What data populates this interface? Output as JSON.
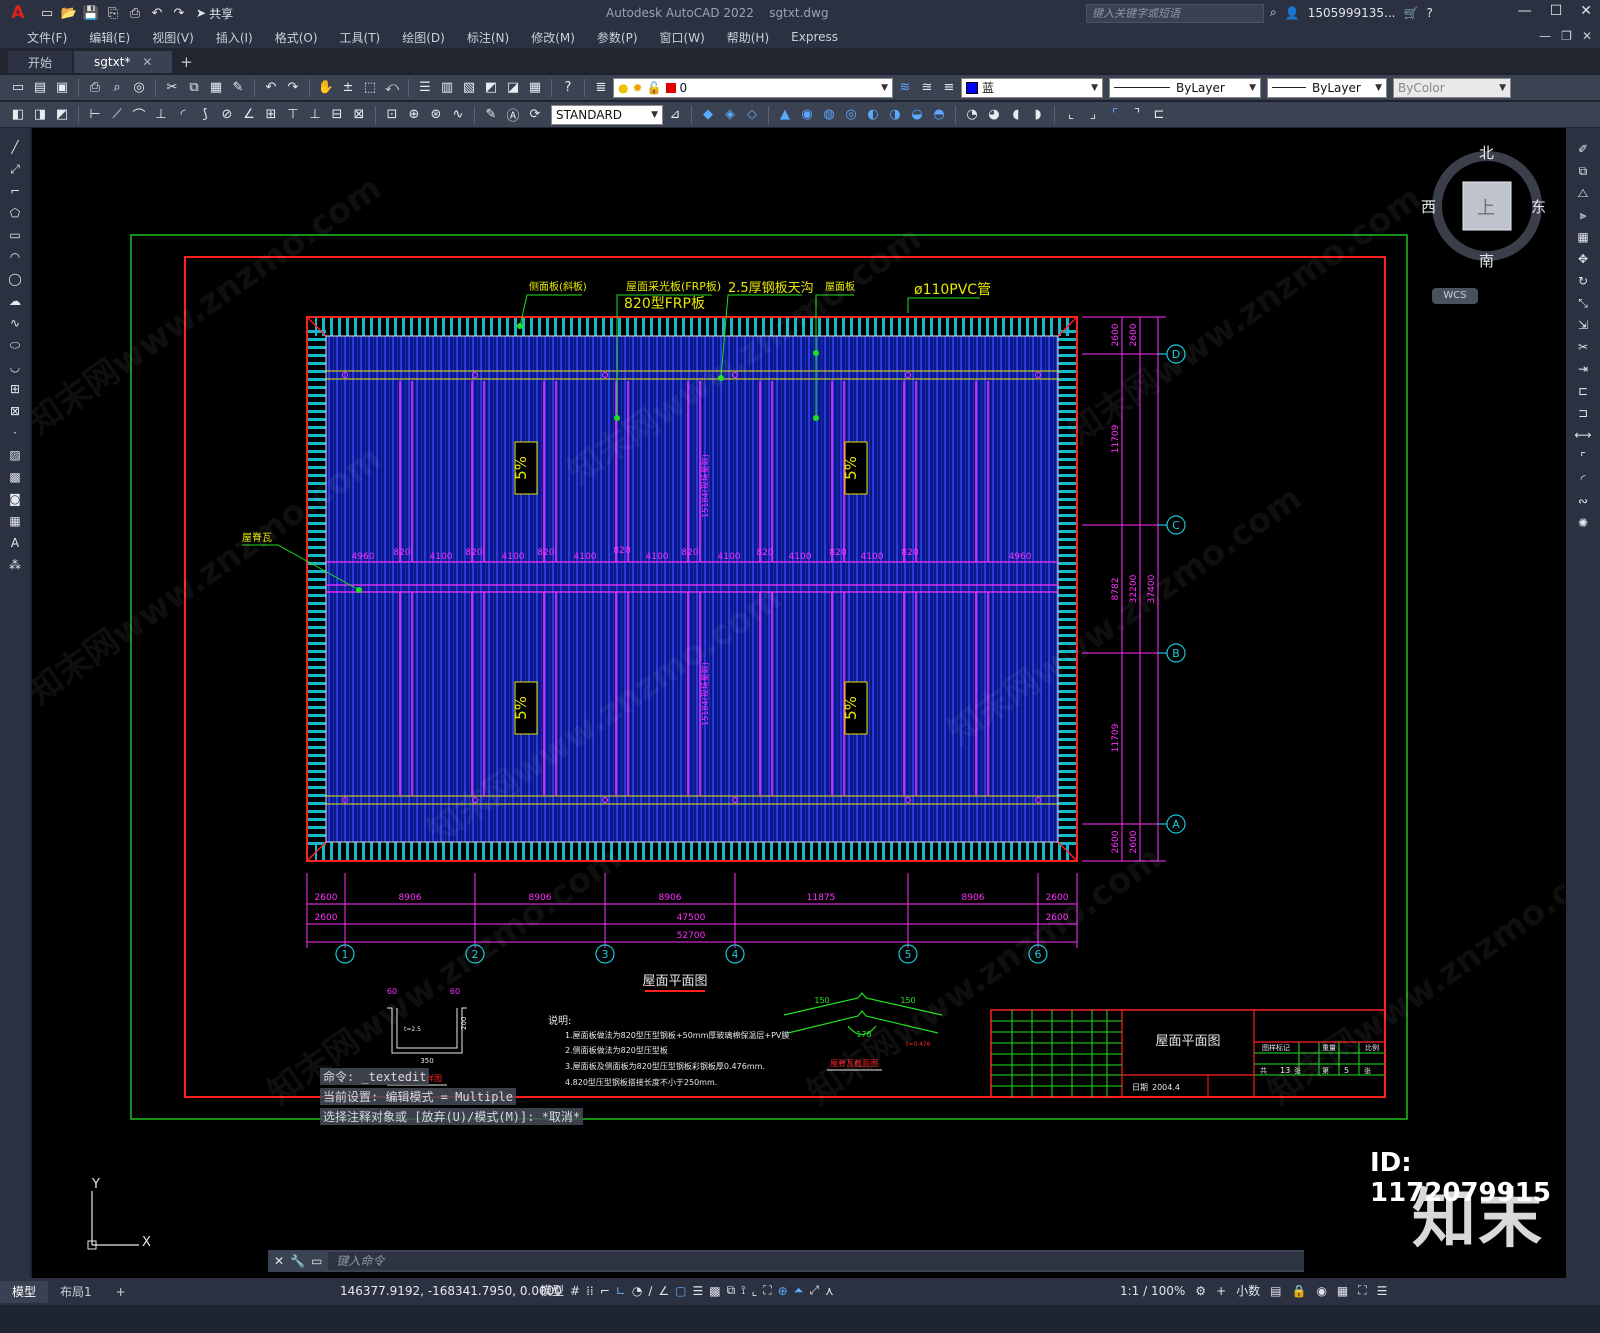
{
  "titlebar": {
    "app_title": "Autodesk AutoCAD 2022",
    "file_name": "sgtxt.dwg",
    "share_label": "共享",
    "search_placeholder": "键入关键字或短语",
    "user_name": "1505999135...",
    "icon_names": [
      "autocad-logo-icon",
      "new-icon",
      "open-icon",
      "save-icon",
      "saveas-icon",
      "plot-icon",
      "undo-icon",
      "redo-icon",
      "share-icon",
      "search-icon",
      "user-icon",
      "cart-icon",
      "help-icon"
    ]
  },
  "menubar": {
    "items": [
      "文件(F)",
      "编辑(E)",
      "视图(V)",
      "插入(I)",
      "格式(O)",
      "工具(T)",
      "绘图(D)",
      "标注(N)",
      "修改(M)",
      "参数(P)",
      "窗口(W)",
      "帮助(H)",
      "Express"
    ]
  },
  "tabs": {
    "items": [
      {
        "label": "开始",
        "active": false
      },
      {
        "label": "sgtxt*",
        "active": true
      }
    ],
    "add_label": "+"
  },
  "properties": {
    "layer_value": "0",
    "color_value": "蓝",
    "color_hex": "#0000ff",
    "linetype_value": "ByLayer",
    "lineweight_value": "ByLayer",
    "plotstyle_value": "ByColor",
    "textstyle_value": "STANDARD"
  },
  "viewcube": {
    "north": "北",
    "south": "南",
    "east": "东",
    "west": "西",
    "top": "上",
    "wcs_label": "WCS"
  },
  "drawing": {
    "callouts": {
      "side_panel": "侧面板(斜板)",
      "skylight_panel": "屋面采光板(FRP板)",
      "frp_spec": "820型FRP板",
      "gutter": "2.5厚钢板天沟",
      "roof_panel": "屋面板",
      "pvc_pipe": "ø110PVC管",
      "ridge_tile": "屋脊瓦"
    },
    "slope_labels": [
      "5%",
      "5%",
      "5%",
      "5%"
    ],
    "top_bay_dims": [
      "4960",
      "820",
      "4100",
      "820",
      "4100",
      "820",
      "4100",
      "820",
      "4100",
      "820",
      "4100",
      "820",
      "4100",
      "820",
      "4100",
      "820",
      "4960"
    ],
    "vertical_dims": [
      "15184(现场量取)",
      "15184(现场量取)"
    ],
    "right_dims": {
      "row1": [
        "2600",
        "2600"
      ],
      "row2": [
        "11709",
        "11709"
      ],
      "row3": [
        "8782",
        "32200",
        "37400"
      ],
      "row4": [
        "2600",
        "2600"
      ]
    },
    "bottom_dims_row1": [
      "2600",
      "8906",
      "8906",
      "8906",
      "11875",
      "8906",
      "2600"
    ],
    "bottom_dims_row2": [
      "2600",
      "47500",
      "2600"
    ],
    "bottom_dims_row3": [
      "52700"
    ],
    "column_axes": [
      "1",
      "2",
      "3",
      "4",
      "5",
      "6"
    ],
    "row_axes": [
      "D",
      "C",
      "B",
      "A"
    ],
    "plan_title": "屋面平面图",
    "gutter_detail": {
      "title": "天沟大样图",
      "dim_left": "60",
      "dim_right": "60",
      "thickness": "t=2.5",
      "height": "200",
      "width": "350"
    },
    "ridge_detail": {
      "title": "屋脊瓦截面图",
      "dim_left": "150",
      "dim_right": "150",
      "dim_center": "178",
      "thickness": "t=0.476"
    },
    "notes": {
      "heading": "说明:",
      "lines": [
        "1.屋面板做法为820型压型钢板+50mm厚玻璃棉保温层+PV膜",
        "2.侧面板做法为820型压型板",
        "3.屋面板及侧面板为820型压型钢板彩钢板厚0.476mm.",
        "4.820型压型钢板搭接长度不小于250mm."
      ]
    },
    "title_block": {
      "drawing_name": "屋面平面图",
      "date_label": "日期",
      "date_value": "2004.4",
      "sheet_total": "13",
      "sheet_no": "5",
      "header_cells": [
        "图样标记",
        "重量",
        "比例"
      ],
      "total_label": "共",
      "page_label": "张",
      "sheet_label": "第",
      "sheet_suffix": "张"
    }
  },
  "command": {
    "history": [
      "命令: _textedit",
      "当前设置: 编辑模式 = Multiple",
      "选择注释对象或 [放弃(U)/模式(M)]: *取消*"
    ],
    "placeholder": "键入命令"
  },
  "ucs": {
    "x_label": "X",
    "y_label": "Y"
  },
  "statusbar": {
    "layout_tabs": [
      "模型",
      "布局1"
    ],
    "coordinates": "146377.9192, -168341.7950, 0.0000",
    "model_label": "模型",
    "scale_label": "1:1 / 100%",
    "units_label": "小数"
  },
  "branding": {
    "mark": "知末",
    "id": "ID: 1172079915",
    "watermark": "知末网www.znzmo.com"
  }
}
